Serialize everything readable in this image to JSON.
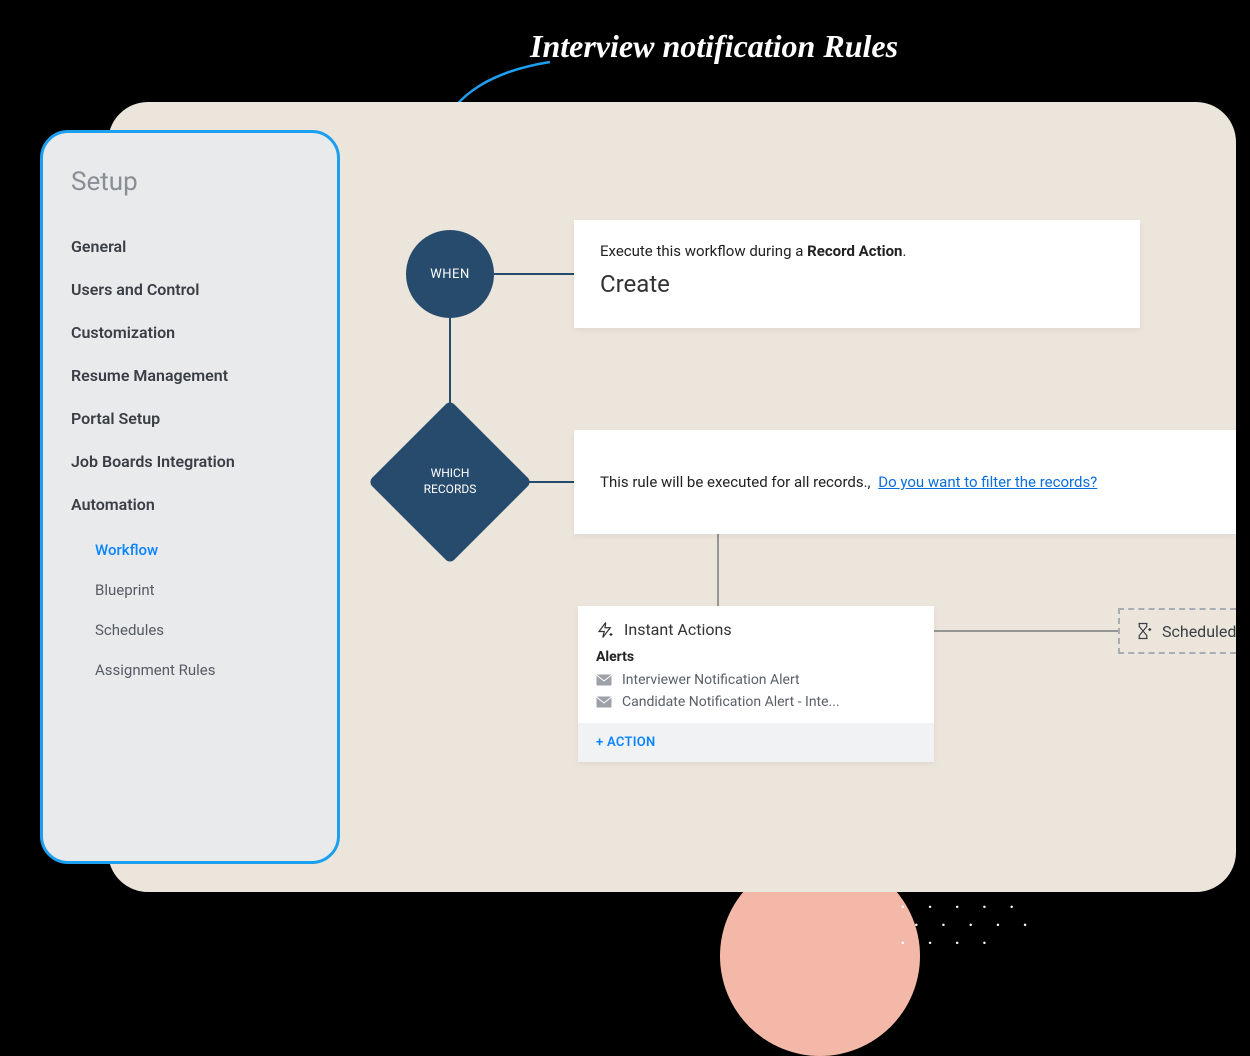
{
  "annotation": {
    "title": "Interview notification Rules"
  },
  "sidebar": {
    "title": "Setup",
    "items": [
      "General",
      "Users and Control",
      "Customization",
      "Resume Management",
      "Portal Setup",
      "Job Boards Integration",
      "Automation"
    ],
    "subitems": [
      "Workflow",
      "Blueprint",
      "Schedules",
      "Assignment Rules"
    ],
    "active_sub": "Workflow"
  },
  "nodes": {
    "when_label": "WHEN",
    "which_label_line1": "WHICH",
    "which_label_line2": "RECORDS"
  },
  "when_card": {
    "prefix": "Execute this workflow during a ",
    "bold": "Record Action",
    "suffix": ".",
    "value": "Create"
  },
  "which_card": {
    "text": "This rule will be executed for all records.,",
    "link": "Do you want to filter the records?"
  },
  "instant": {
    "title": "Instant Actions",
    "section": "Alerts",
    "alerts": [
      "Interviewer Notification Alert",
      "Candidate Notification Alert - Inte..."
    ],
    "add": "+ ACTION"
  },
  "scheduled": {
    "title": "Scheduled Actions"
  }
}
